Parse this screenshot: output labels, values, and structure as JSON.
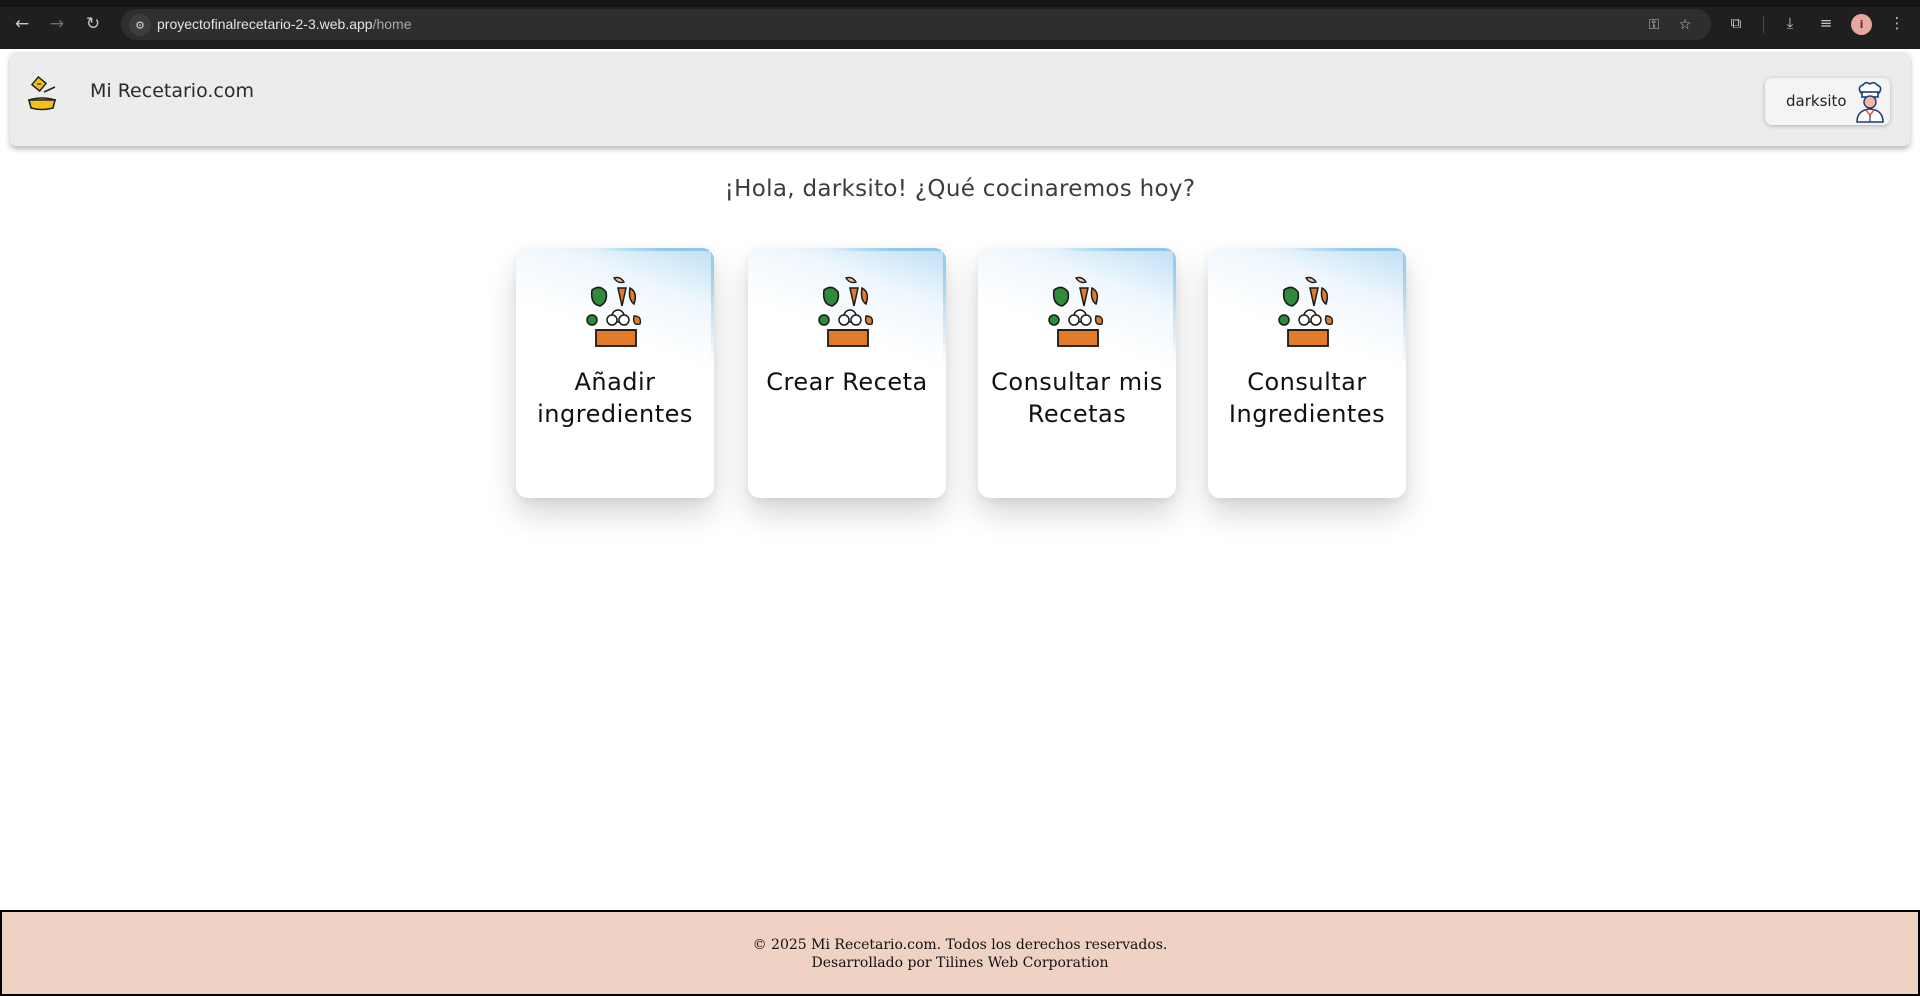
{
  "browser": {
    "url_host": "proyectofinalrecetario-2-3.web.app",
    "url_path": "/home",
    "profile_initial": "i"
  },
  "header": {
    "brand": "Mi Recetario.com",
    "username": "darksito"
  },
  "main": {
    "greeting": "¡Hola, darksito! ¿Qué cocinaremos hoy?",
    "cards": [
      {
        "label": "Añadir ingredientes"
      },
      {
        "label": "Crear Receta"
      },
      {
        "label": "Consultar mis Recetas"
      },
      {
        "label": "Consultar Ingredientes"
      }
    ]
  },
  "footer": {
    "line1": "© 2025 Mi Recetario.com. Todos los derechos reservados.",
    "line2": "Desarrollado por Tilines Web Corporation"
  },
  "colors": {
    "chrome_bg": "#1f1f1f",
    "header_bg": "#ececec",
    "footer_bg": "#f0d2c4",
    "card_accent": "#8fc8ea"
  }
}
